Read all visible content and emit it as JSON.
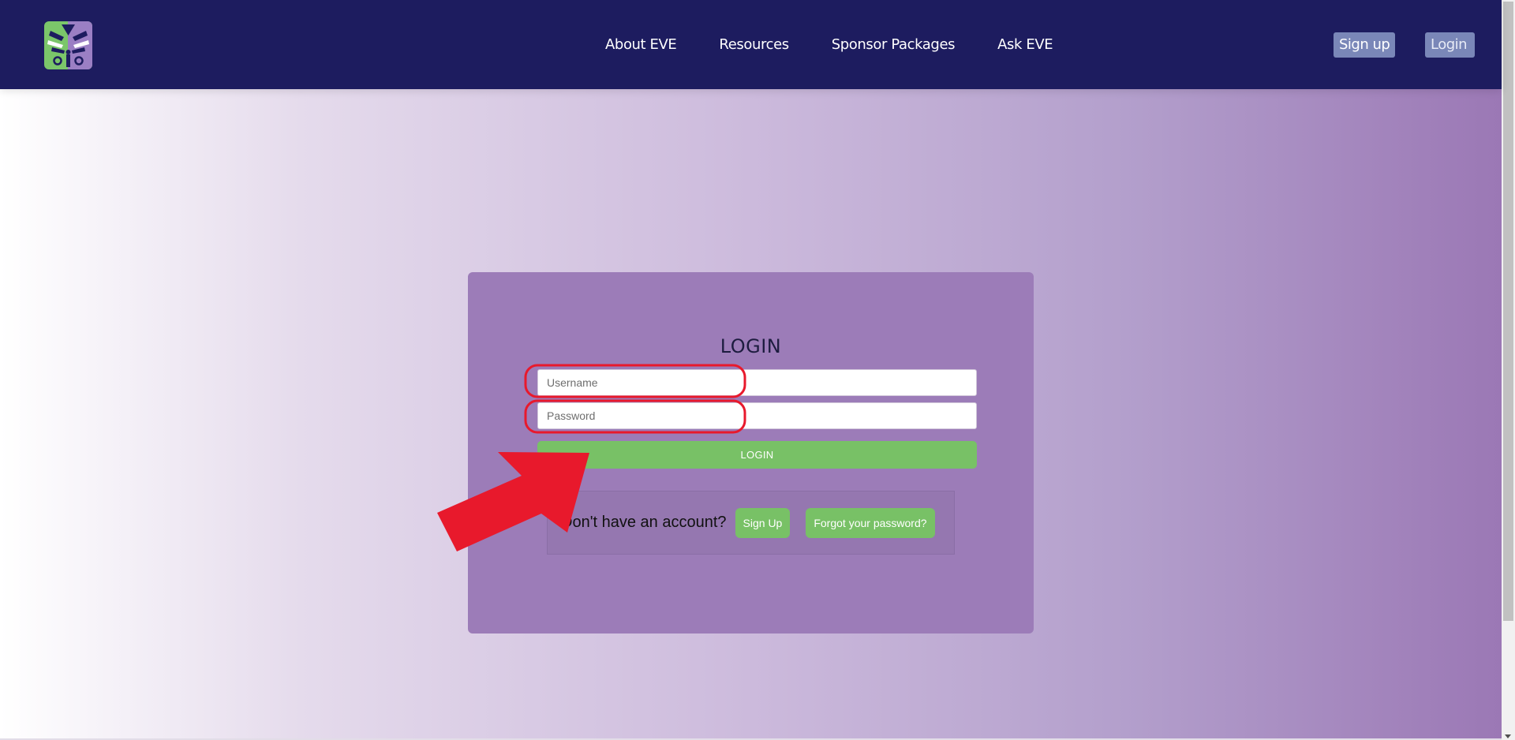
{
  "nav": {
    "logo": "eve-logo-icon",
    "links": [
      "About EVE",
      "Resources",
      "Sponsor Packages",
      "Ask EVE"
    ],
    "signup_label": "Sign up",
    "login_label": "Login"
  },
  "login_form": {
    "title": "LOGIN",
    "username_placeholder": "Username",
    "password_placeholder": "Password",
    "submit_label": "LOGIN",
    "no_account_text": "Don't have an account?",
    "signup_label": "Sign Up",
    "forgot_label": "Forgot your password?"
  },
  "colors": {
    "nav_bg": "#1d1c5f",
    "card_bg": "#9c7cb8",
    "button_green": "#78c166",
    "annotation_red": "#e8192c"
  }
}
